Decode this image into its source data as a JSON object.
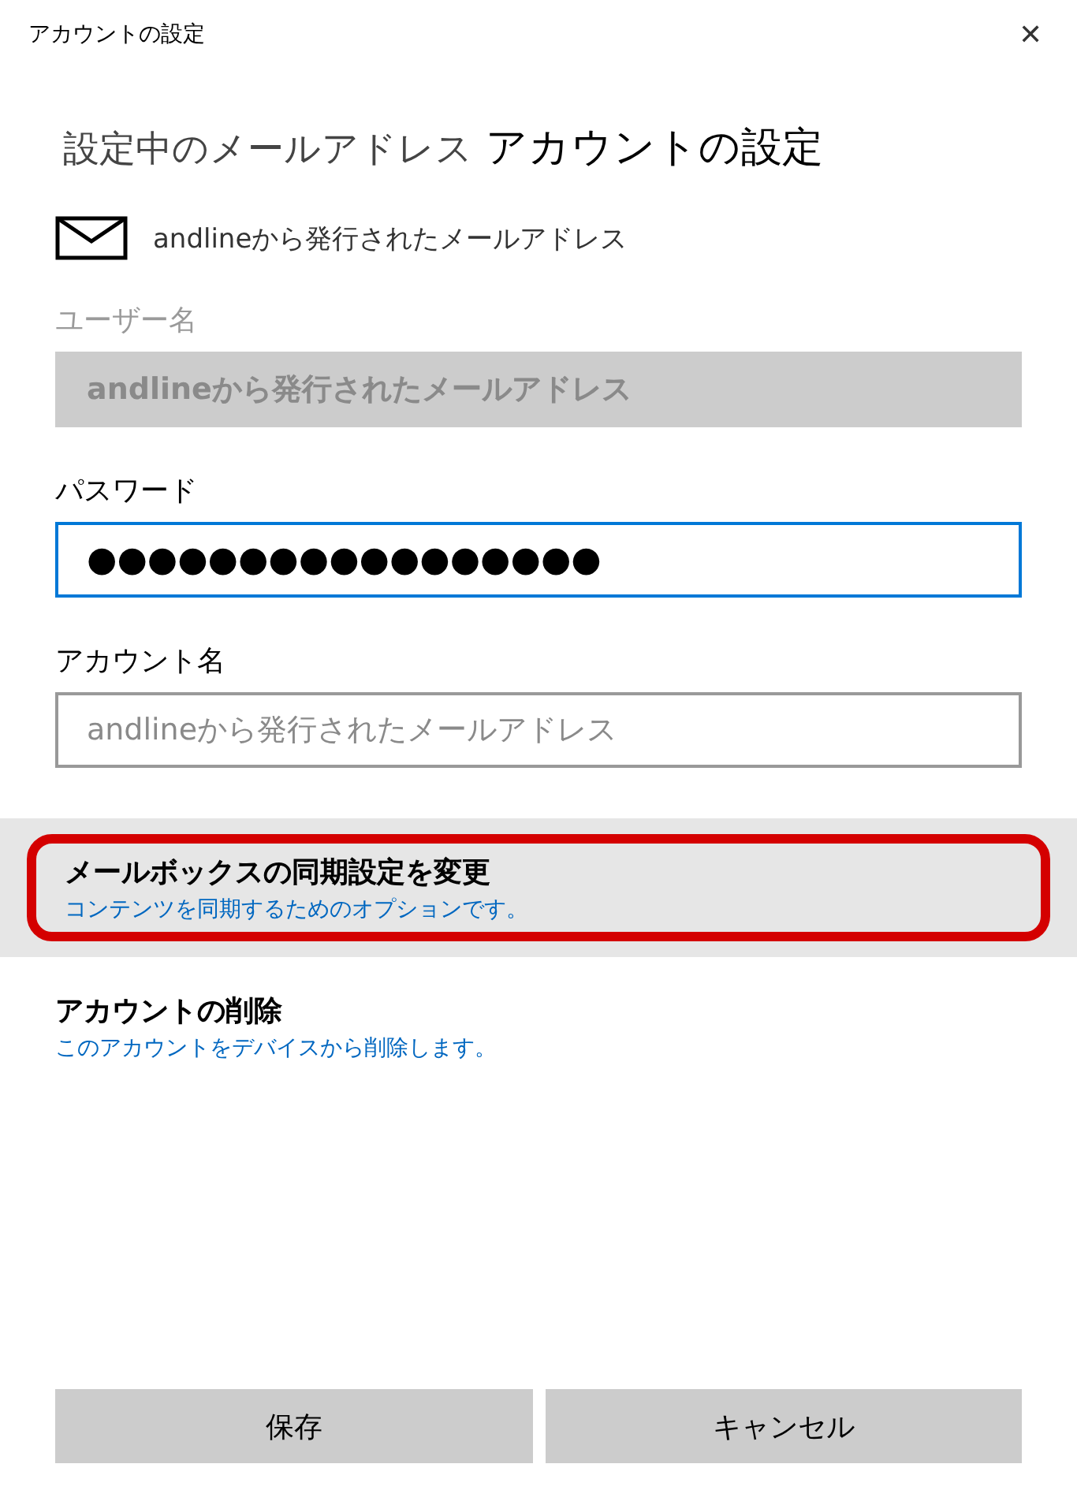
{
  "window": {
    "title": "アカウントの設定",
    "close": "✕"
  },
  "heading": {
    "prefix": "設定中のメールアドレス",
    "title": "アカウントの設定"
  },
  "account": {
    "address": "andlineから発行されたメールアドレス"
  },
  "fields": [
    {
      "label": "ユーザー名",
      "value": "andlineから発行されたメールアドレス",
      "disabled": true,
      "focused": false
    },
    {
      "label": "パスワード",
      "value": "●●●●●●●●●●●●●●●●●",
      "disabled": false,
      "focused": true
    },
    {
      "label": "アカウント名",
      "placeholder": "andlineから発行されたメールアドレス",
      "disabled": false,
      "focused": false
    }
  ],
  "options": [
    {
      "title": "メールボックスの同期設定を変更",
      "description": "コンテンツを同期するためのオプションです。",
      "selected": true,
      "highlighted": true
    },
    {
      "title": "アカウントの削除",
      "description": "このアカウントをデバイスから削除します。",
      "selected": false,
      "highlighted": false
    }
  ],
  "buttons": [
    "保存",
    "キャンセル"
  ]
}
